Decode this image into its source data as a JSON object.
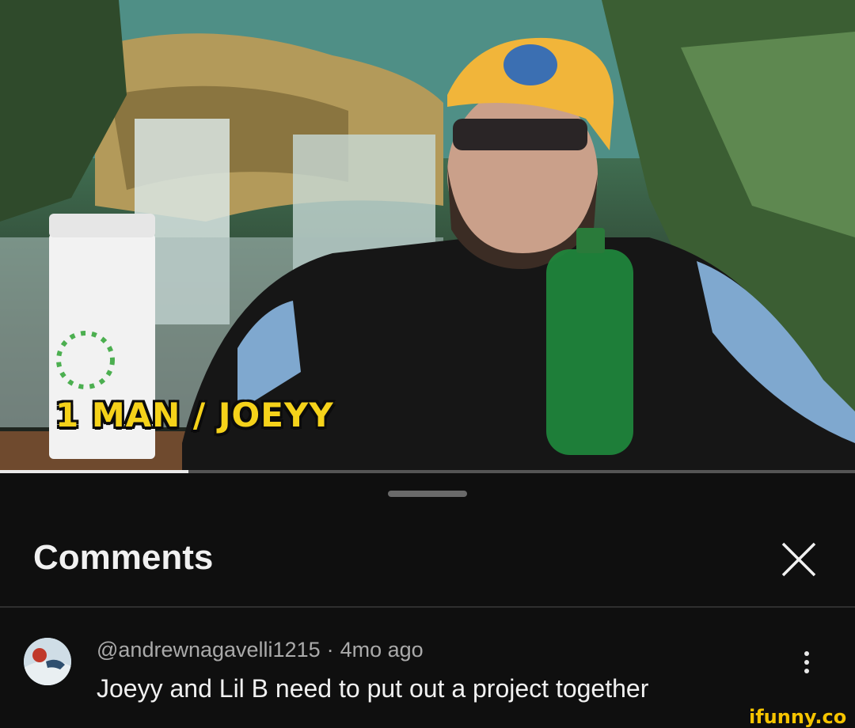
{
  "video": {
    "caption": "1 MAN / JOEYY",
    "progress": 0.22
  },
  "comments_panel": {
    "title": "Comments",
    "close_icon": "close-icon",
    "items": [
      {
        "author": "@andrewnagavelli1215",
        "time": "4mo ago",
        "text": "Joeyy and Lil B need to put out a project together",
        "menu_icon": "more-vert-icon"
      }
    ]
  },
  "watermark": "ifunny.co",
  "colors": {
    "background": "#0f0f0f",
    "title": "#f1f1f1",
    "meta": "#aaaaaa",
    "caption": "#f5d21a",
    "watermark": "#f5c400"
  }
}
